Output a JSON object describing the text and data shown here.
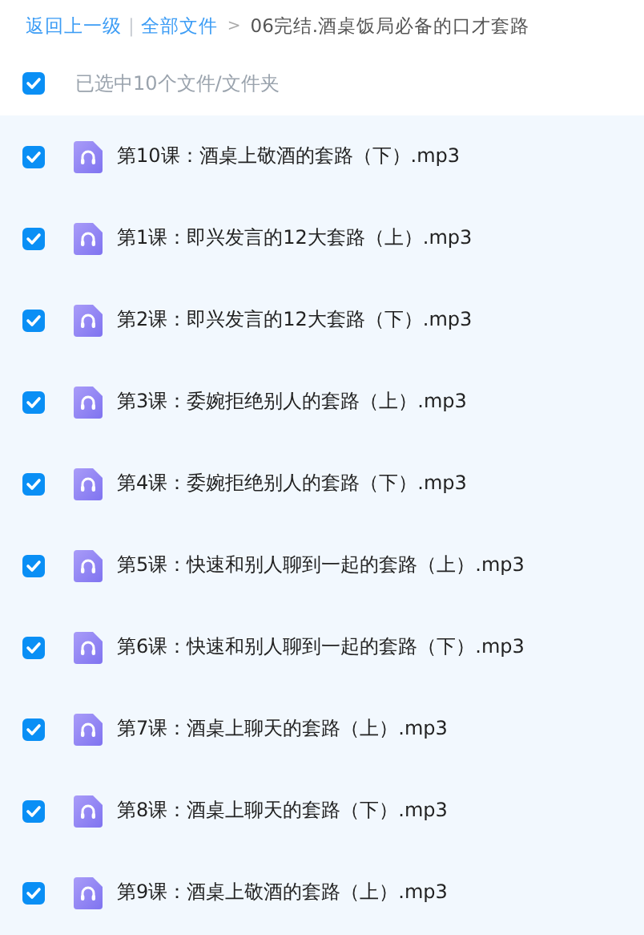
{
  "breadcrumb": {
    "back": "返回上一级",
    "separator": "|",
    "root": "全部文件",
    "arrow": ">",
    "current": "06完结.酒桌饭局必备的口才套路"
  },
  "selection": {
    "checked": true,
    "label": "已选中10个文件/文件夹"
  },
  "files": [
    {
      "name": "第10课：酒桌上敬酒的套路（下）.mp3",
      "checked": true
    },
    {
      "name": "第1课：即兴发言的12大套路（上）.mp3",
      "checked": true
    },
    {
      "name": "第2课：即兴发言的12大套路（下）.mp3",
      "checked": true
    },
    {
      "name": "第3课：委婉拒绝别人的套路（上）.mp3",
      "checked": true
    },
    {
      "name": "第4课：委婉拒绝别人的套路（下）.mp3",
      "checked": true
    },
    {
      "name": "第5课：快速和别人聊到一起的套路（上）.mp3",
      "checked": true
    },
    {
      "name": "第6课：快速和别人聊到一起的套路（下）.mp3",
      "checked": true
    },
    {
      "name": "第7课：酒桌上聊天的套路（上）.mp3",
      "checked": true
    },
    {
      "name": "第8课：酒桌上聊天的套路（下）.mp3",
      "checked": true
    },
    {
      "name": "第9课：酒桌上敬酒的套路（上）.mp3",
      "checked": true
    }
  ]
}
